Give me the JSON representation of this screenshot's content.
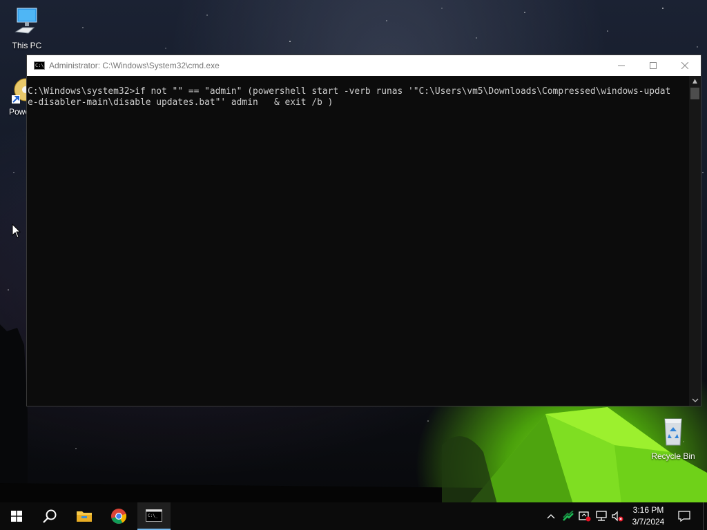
{
  "desktop": {
    "icons": [
      {
        "label": "This PC",
        "icon": "computer-icon"
      },
      {
        "label": "Powe",
        "icon": "powershell-shortcut-icon"
      },
      {
        "label": "Recycle Bin",
        "icon": "recycle-bin-icon"
      }
    ]
  },
  "cmd_window": {
    "title": "Administrator: C:\\Windows\\System32\\cmd.exe",
    "lines": [
      "C:\\Windows\\system32>if not \"\" == \"admin\" (powershell start -verb runas '\"C:\\Users\\vm5\\Downloads\\Compressed\\windows-updat",
      "e-disabler-main\\disable updates.bat\"' admin   & exit /b )"
    ],
    "buttons": {
      "minimize": "minimize-icon",
      "maximize": "maximize-icon",
      "close": "close-icon"
    }
  },
  "taskbar": {
    "pinned": [
      {
        "name": "start",
        "icon": "windows-logo-icon"
      },
      {
        "name": "search",
        "icon": "search-icon"
      },
      {
        "name": "file-explorer",
        "icon": "folder-icon"
      },
      {
        "name": "chrome",
        "icon": "chrome-icon"
      },
      {
        "name": "cmd",
        "icon": "terminal-icon",
        "active": true
      }
    ],
    "tray": {
      "time": "3:16 PM",
      "date": "3/7/2024"
    }
  }
}
